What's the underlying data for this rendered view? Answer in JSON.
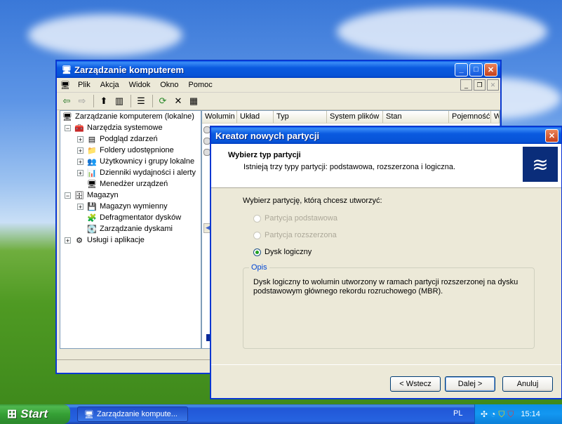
{
  "main_window": {
    "title": "Zarządzanie komputerem",
    "menu": [
      "Plik",
      "Akcja",
      "Widok",
      "Okno",
      "Pomoc"
    ],
    "tree": [
      {
        "label": "Zarządzanie komputerem (lokalne)",
        "level": 0,
        "expander": ""
      },
      {
        "label": "Narzędzia systemowe",
        "level": 1,
        "expander": "−"
      },
      {
        "label": "Podgląd zdarzeń",
        "level": 2,
        "expander": "+"
      },
      {
        "label": "Foldery udostępnione",
        "level": 2,
        "expander": "+"
      },
      {
        "label": "Użytkownicy i grupy lokalne",
        "level": 2,
        "expander": "+"
      },
      {
        "label": "Dzienniki wydajności i alerty",
        "level": 2,
        "expander": "+"
      },
      {
        "label": "Menedżer urządzeń",
        "level": 2,
        "expander": ""
      },
      {
        "label": "Magazyn",
        "level": 1,
        "expander": "−"
      },
      {
        "label": "Magazyn wymienny",
        "level": 2,
        "expander": "+"
      },
      {
        "label": "Defragmentator dysków",
        "level": 2,
        "expander": ""
      },
      {
        "label": "Zarządzanie dyskami",
        "level": 2,
        "expander": ""
      },
      {
        "label": "Usługi i aplikacje",
        "level": 1,
        "expander": "+"
      }
    ],
    "columns": [
      "Wolumin",
      "Układ",
      "Typ",
      "System plików",
      "Stan",
      "Pojemność",
      "W"
    ]
  },
  "wizard": {
    "title": "Kreator nowych partycji",
    "heading": "Wybierz typ partycji",
    "subheading": "Istnieją trzy typy partycji: podstawowa, rozszerzona i logiczna.",
    "prompt": "Wybierz partycję, którą chcesz utworzyć:",
    "options": [
      {
        "label": "Partycja podstawowa",
        "enabled": false,
        "selected": false
      },
      {
        "label": "Partycja rozszerzona",
        "enabled": false,
        "selected": false
      },
      {
        "label": "Dysk logiczny",
        "enabled": true,
        "selected": true
      }
    ],
    "group_label": "Opis",
    "description": "Dysk logiczny to wolumin utworzony w ramach partycji rozszerzonej na dysku podstawowym głównego rekordu rozruchowego (MBR).",
    "buttons": {
      "back": "< Wstecz",
      "next": "Dalej >",
      "cancel": "Anuluj"
    }
  },
  "taskbar": {
    "start_label": "Start",
    "task_label": "Zarządzanie kompute...",
    "language": "PL",
    "clock": "15:14"
  },
  "colors": {
    "titlebar": "#0a5ae0",
    "close": "#c5401c",
    "desktop_sky": "#5d95e6",
    "desktop_grass": "#4f9a23"
  }
}
